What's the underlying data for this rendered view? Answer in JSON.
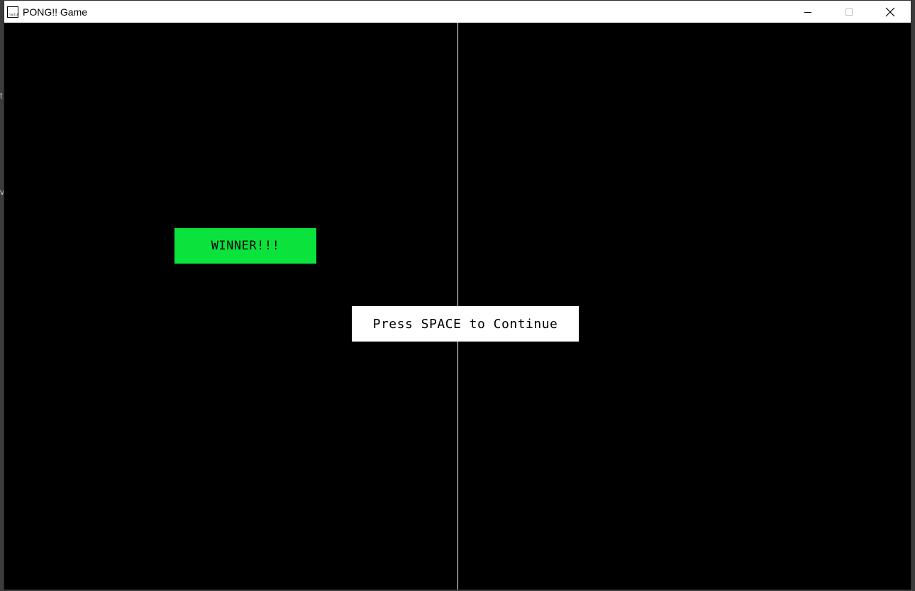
{
  "window": {
    "title": "PONG!! Game",
    "icon": "raylib-icon",
    "icon_text": "raylib",
    "controls": [
      "minimize-icon",
      "maximize-icon",
      "close-icon"
    ]
  },
  "game": {
    "winner_label": "WINNER!!!",
    "continue_label": "Press SPACE to Continue",
    "winner_side": "left"
  },
  "colors": {
    "background": "#000000",
    "center_line": "#ffffff",
    "winner_box": "#0be33d",
    "continue_box": "#ffffff"
  }
}
